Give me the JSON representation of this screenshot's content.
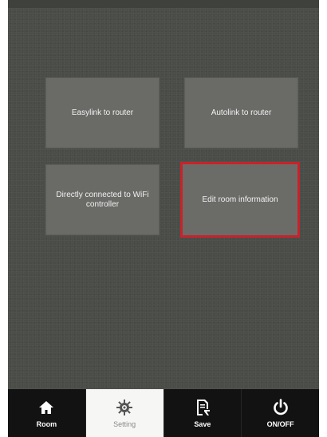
{
  "tiles": {
    "easylink": "Easylink to router",
    "autolink": "Autolink to router",
    "direct": "Directly connected to WiFi controller",
    "edit": "Edit room information"
  },
  "tabs": {
    "room": {
      "label": "Room",
      "icon": "home-icon"
    },
    "setting": {
      "label": "Setting",
      "icon": "gear-icon"
    },
    "save": {
      "label": "Save",
      "icon": "save-icon"
    },
    "onoff": {
      "label": "ON/OFF",
      "icon": "power-icon"
    }
  },
  "colors": {
    "selected_border": "#c8222a",
    "background": "#4a4c48",
    "tabbar": "#121212"
  }
}
